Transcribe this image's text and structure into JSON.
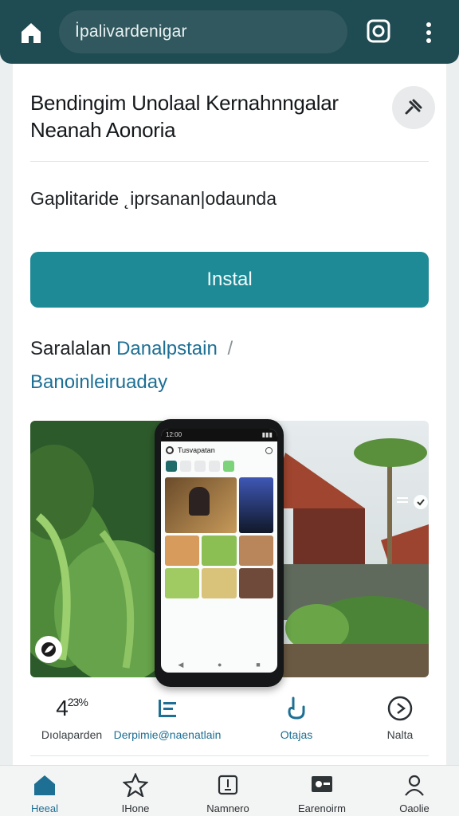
{
  "browser": {
    "url": "İpalivardenigar"
  },
  "app": {
    "title": "Bendingim Unolaal Kernahnngalar Neanah Aonoria",
    "subtitle": "Gaplitaride ˛iprsanan|odaunda",
    "install_label": "Instal",
    "info_prefix": "Saralalan",
    "info_link": "Danalpstain",
    "info_slash": "/",
    "info_link2": "Banoinleiruaday"
  },
  "stats": {
    "rating_value": "4",
    "rating_extra": "23%",
    "rating_label": "Dıolaparden",
    "developer_label": "Derpimie@naenatlain",
    "size_label": "Otajas",
    "play_label": "Nalta"
  },
  "bottom_nav": {
    "items": [
      {
        "label": "Heeal"
      },
      {
        "label": "IHone"
      },
      {
        "label": "Namnero"
      },
      {
        "label": "Earenoirm"
      },
      {
        "label": "Oaolie"
      }
    ]
  },
  "phone_mock": {
    "app_title": "Tusvapatan",
    "status_time": "12:00"
  },
  "colors": {
    "topbar": "#1f4b52",
    "accent": "#1e8a96",
    "link": "#1d6f94"
  }
}
